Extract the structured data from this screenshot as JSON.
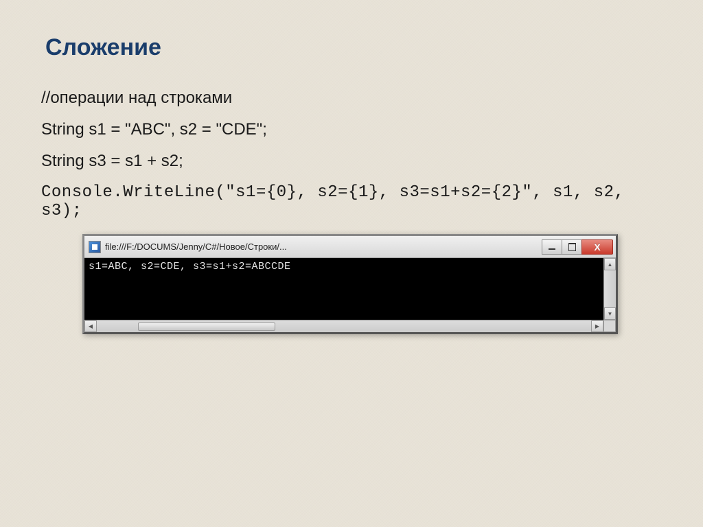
{
  "heading": "Сложение",
  "code": {
    "line1": "//операции над строками",
    "line2": "String s1 = \"ABC\", s2 = \"CDE\";",
    "line3": "String s3 = s1 + s2;",
    "line4": "Console.WriteLine(\"s1={0}, s2={1}, s3=s1+s2={2}\", s1, s2, s3);"
  },
  "console": {
    "title_path": "file:///F:/DOCUMS/Jenny/C#/Новое/Строки/...",
    "output": "s1=ABC, s2=CDE, s3=s1+s2=ABCCDE",
    "close_label": "X"
  }
}
